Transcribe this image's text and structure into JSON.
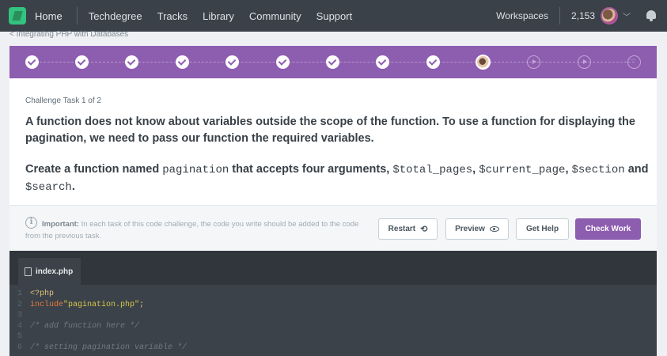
{
  "nav": {
    "home": "Home",
    "links": [
      "Techdegree",
      "Tracks",
      "Library",
      "Community",
      "Support"
    ],
    "workspaces": "Workspaces",
    "points": "2,153",
    "chevron": "﹀"
  },
  "breadcrumb": "< Integrating PHP with Databases",
  "progress": {
    "steps": [
      "done",
      "done",
      "done",
      "done",
      "done",
      "done",
      "done",
      "done",
      "done",
      "current",
      "video",
      "video",
      "more"
    ]
  },
  "task": {
    "label": "Challenge Task 1 of 2",
    "p1": "A function does not know about variables outside the scope of the function. To use a function for displaying the pagination, we need to pass our function the required variables.",
    "p2_prefix": "Create a function named ",
    "p2_code1": "pagination",
    "p2_mid": " that accepts four arguments, ",
    "p2_code2": "$total_pages",
    "p2_sep1": ", ",
    "p2_code3": "$current_page",
    "p2_sep2": ", ",
    "p2_code4": "$section",
    "p2_and": " and ",
    "p2_code5": "$search",
    "p2_end": "."
  },
  "actions": {
    "info_glyph": "i",
    "important_label": "Important:",
    "important_text": " In each task of this code challenge, the code you write should be added to the code from the previous task.",
    "restart": "Restart",
    "restart_glyph": "⟲",
    "preview": "Preview",
    "help": "Get Help",
    "check": "Check Work"
  },
  "editor": {
    "tab": "index.php",
    "lines": [
      {
        "n": "1",
        "a": "<?php",
        "b": ""
      },
      {
        "n": "2",
        "a": "include ",
        "b": "\"pagination.php\"",
        "c": ";"
      },
      {
        "n": "3",
        "a": "",
        "b": ""
      },
      {
        "n": "4",
        "a": "/* add function here */",
        "b": ""
      },
      {
        "n": "5",
        "a": "",
        "b": ""
      },
      {
        "n": "6",
        "a": "/* setting pagination variable */",
        "b": ""
      }
    ]
  },
  "colors": {
    "nav_bg": "#3a4148",
    "accent_purple": "#8d5db0",
    "brand_green": "#33c27f",
    "editor_bg": "#3b4249"
  }
}
